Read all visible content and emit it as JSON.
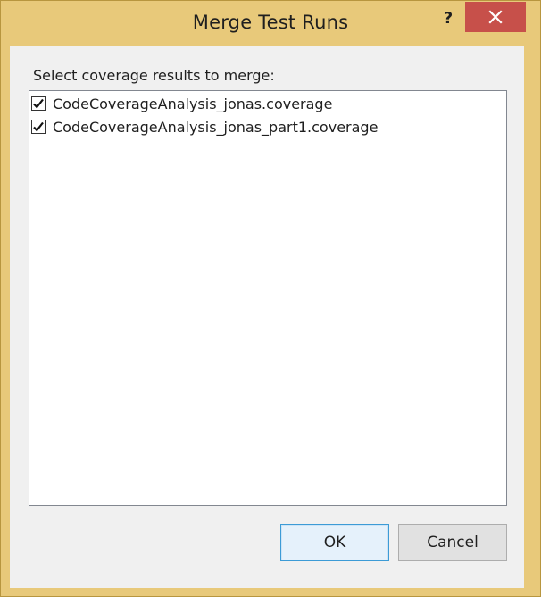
{
  "window": {
    "title": "Merge Test Runs",
    "help_label": "?",
    "close_icon": "close-icon"
  },
  "prompt": "Select coverage results to merge:",
  "items": [
    {
      "label": "CodeCoverageAnalysis_jonas.coverage",
      "checked": true
    },
    {
      "label": "CodeCoverageAnalysis_jonas_part1.coverage",
      "checked": true
    }
  ],
  "buttons": {
    "ok_label": "OK",
    "cancel_label": "Cancel"
  },
  "colors": {
    "frame": "#e8c97a",
    "close_button": "#c7504a",
    "client": "#f0f0f0",
    "default_button_border": "#3c9bd6"
  }
}
